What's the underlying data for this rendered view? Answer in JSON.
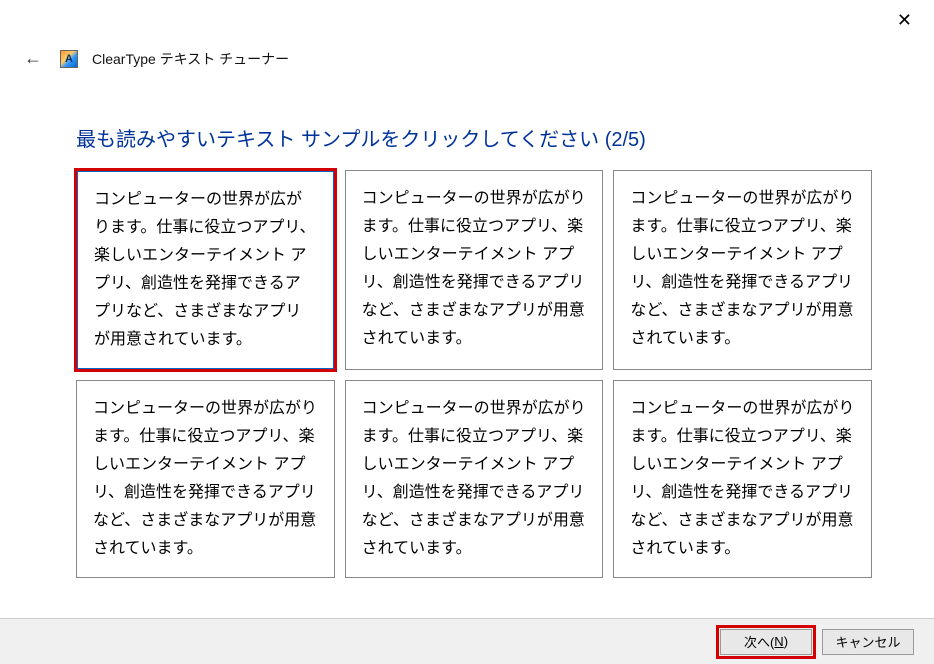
{
  "window": {
    "title": "ClearType テキスト チューナー"
  },
  "heading": "最も読みやすいテキスト サンプルをクリックしてください (2/5)",
  "sample_text": "コンピューターの世界が広がります。仕事に役立つアプリ、楽しいエンターテイメント アプリ、創造性を発揮できるアプリなど、さまざまなアプリが用意されています。",
  "selected_index": 0,
  "buttons": {
    "next_prefix": "次へ(",
    "next_key": "N",
    "next_suffix": ")",
    "cancel": "キャンセル"
  }
}
